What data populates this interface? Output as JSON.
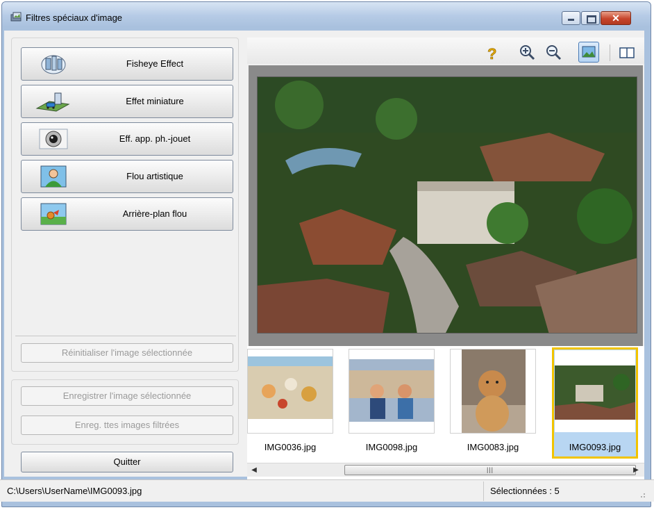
{
  "window": {
    "title": "Filtres spéciaux d'image",
    "title_icon": "image-filter-app-icon",
    "minimize_icon": "minimize-icon",
    "maximize_icon": "maximize-icon",
    "close_icon": "close-icon",
    "close_glyph": "✕"
  },
  "effects": {
    "items": [
      {
        "label": "Fisheye Effect",
        "icon": "fisheye-icon"
      },
      {
        "label": "Effet miniature",
        "icon": "miniature-icon"
      },
      {
        "label": "Eff. app. ph.-jouet",
        "icon": "toy-camera-icon"
      },
      {
        "label": "Flou artistique",
        "icon": "soft-focus-portrait-icon"
      },
      {
        "label": "Arrière-plan flou",
        "icon": "blur-background-icon"
      }
    ]
  },
  "actions": {
    "reset_label": "Réinitialiser l'image sélectionnée",
    "save_selected_label": "Enregistrer l'image sélectionnée",
    "save_all_label": "Enreg. ttes images filtrées",
    "quit_label": "Quitter"
  },
  "toolbar": {
    "help_icon": "help-icon",
    "zoom_in_icon": "zoom-in-icon",
    "zoom_out_icon": "zoom-out-icon",
    "single_view_icon": "single-view-icon",
    "compare_view_icon": "compare-view-icon"
  },
  "thumbnails": [
    {
      "filename": "IMG0036.jpg",
      "selected": false
    },
    {
      "filename": "IMG0098.jpg",
      "selected": false
    },
    {
      "filename": "IMG0083.jpg",
      "selected": false
    },
    {
      "filename": "IMG0093.jpg",
      "selected": true
    }
  ],
  "scrollbar": {
    "grip": "|||",
    "left_arrow": "◀",
    "right_arrow": "▶"
  },
  "status": {
    "path": "C:\\Users\\UserName\\IMG0093.jpg",
    "selected_count": "Sélectionnées : 5"
  },
  "colors": {
    "selection_frame": "#f2c400",
    "selection_fill": "#b8d6f2",
    "titlebar": "#b6cbe6"
  }
}
